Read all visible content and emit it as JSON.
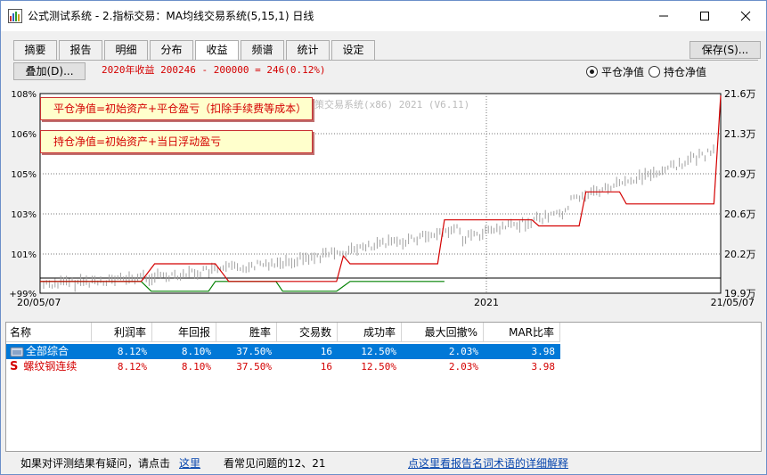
{
  "window": {
    "title": "公式测试系统 - 2.指标交易：MA均线交易系统(5,15,1) 日线",
    "minimize": "—",
    "maximize": "☐",
    "close": "✕"
  },
  "tabs": [
    {
      "label": "摘要",
      "active": false
    },
    {
      "label": "报告",
      "active": false
    },
    {
      "label": "明细",
      "active": false
    },
    {
      "label": "分布",
      "active": false
    },
    {
      "label": "收益",
      "active": true
    },
    {
      "label": "频谱",
      "active": false
    },
    {
      "label": "统计",
      "active": false
    },
    {
      "label": "设定",
      "active": false
    }
  ],
  "save_button": "保存(S)...",
  "overlay_button": "叠加(D)...",
  "summary": {
    "label": "2020年收益",
    "text": "200246 - 200000 = 246(0.12%)"
  },
  "radios": [
    {
      "label": "平仓净值",
      "checked": true
    },
    {
      "label": "持仓净值",
      "checked": false
    }
  ],
  "chart_data": {
    "type": "line",
    "watermark": "策交易系统(x86) 2021 (V6.11)",
    "left_axis_ticks": [
      "108%",
      "106%",
      "105%",
      "103%",
      "101%",
      "+99%"
    ],
    "right_axis_ticks": [
      "21.6万",
      "21.3万",
      "20.9万",
      "20.6万",
      "20.2万",
      "19.9万"
    ],
    "x_ticks": [
      "20/05/07",
      "2021",
      "21/05/07"
    ],
    "legend": [
      "平仓净值=初始资产+平仓盈亏（扣除手续费等成本）",
      "持仓净值=初始资产+当日浮动盈亏"
    ],
    "colors": {
      "closed_equity": "#d40000",
      "underwater": "#008000",
      "price": "#a0a0a0"
    },
    "closed_equity_pct": [
      [
        0,
        99.6
      ],
      [
        30,
        99.6
      ],
      [
        34,
        100.5
      ],
      [
        52,
        100.5
      ],
      [
        56,
        99.6
      ],
      [
        88,
        99.6
      ],
      [
        90,
        100.9
      ],
      [
        92,
        100.5
      ],
      [
        118,
        100.5
      ],
      [
        120,
        102.7
      ],
      [
        146,
        102.7
      ],
      [
        148,
        102.4
      ],
      [
        160,
        102.4
      ],
      [
        162,
        104.1
      ],
      [
        172,
        104.1
      ],
      [
        174,
        103.5
      ],
      [
        200,
        103.5
      ],
      [
        202,
        107.9
      ]
    ],
    "underwater_pct": [
      [
        0,
        99.6
      ],
      [
        30,
        99.6
      ],
      [
        33,
        99.1
      ],
      [
        50,
        99.1
      ],
      [
        52,
        99.6
      ],
      [
        70,
        99.6
      ],
      [
        72,
        99.1
      ],
      [
        88,
        99.1
      ],
      [
        92,
        99.6
      ],
      [
        120,
        99.6
      ]
    ]
  },
  "table": {
    "headers": [
      "名称",
      "利润率",
      "年回报",
      "胜率",
      "交易数",
      "成功率",
      "最大回撤%",
      "MAR比率"
    ],
    "rows": [
      {
        "icon": "folder-icon",
        "name": "全部综合",
        "values": [
          "8.12%",
          "8.10%",
          "37.50%",
          "16",
          "12.50%",
          "2.03%",
          "3.98"
        ],
        "selected": true
      },
      {
        "icon": "s-icon",
        "icon_text": "S",
        "name": "螺纹钢连续",
        "values": [
          "8.12%",
          "8.10%",
          "37.50%",
          "16",
          "12.50%",
          "2.03%",
          "3.98"
        ],
        "selected": false
      }
    ]
  },
  "footer": {
    "prefix": "如果对评测结果有疑问，请点击",
    "link1": "这里",
    "middle": "看常见问题的12、21",
    "link2": "点这里看报告名词术语的详细解释"
  }
}
